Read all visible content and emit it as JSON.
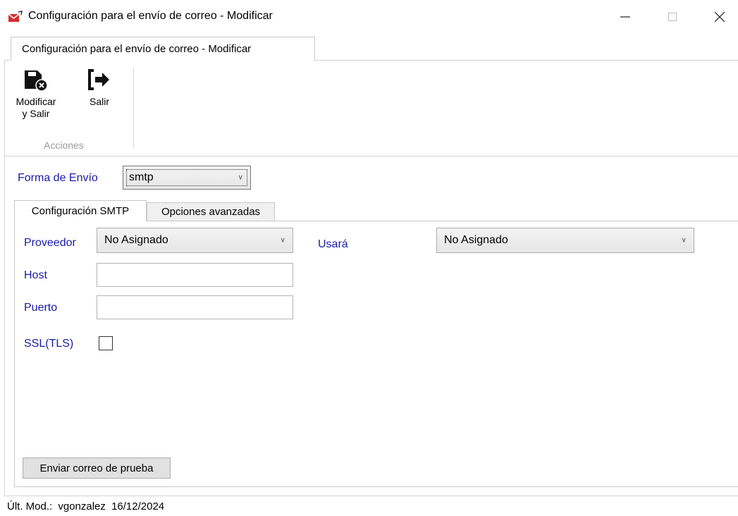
{
  "window": {
    "title": "Configuración para el envío de correo - Modificar",
    "icon": "app-envelope-icon"
  },
  "ribbon": {
    "tab_label": "Configuración para el envío de correo - Modificar",
    "buttons": [
      {
        "label": "Modificar\ny Salir",
        "icon": "save-close-icon"
      },
      {
        "label": "Salir",
        "icon": "exit-icon"
      }
    ],
    "group_label": "Acciones"
  },
  "form": {
    "forma_envio_label": "Forma de Envío",
    "forma_envio_value": "smtp"
  },
  "tabs": [
    {
      "label": "Configuración SMTP",
      "active": true
    },
    {
      "label": "Opciones avanzadas",
      "active": false
    }
  ],
  "smtp": {
    "proveedor_label": "Proveedor",
    "proveedor_value": "No Asignado",
    "usara_label": "Usará",
    "usara_value": "No Asignado",
    "host_label": "Host",
    "host_value": "",
    "puerto_label": "Puerto",
    "puerto_value": "",
    "ssl_label": "SSL(TLS)",
    "ssl_checked": false,
    "test_button_label": "Enviar correo de prueba"
  },
  "status": {
    "label": "Últ. Mod.:",
    "user": "vgonzalez",
    "date": "16/12/2024"
  },
  "colors": {
    "label_blue": "#1a1aa8",
    "icon_red": "#d32f2f"
  }
}
